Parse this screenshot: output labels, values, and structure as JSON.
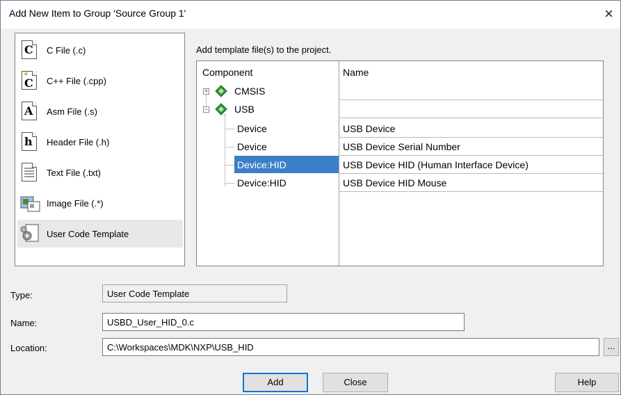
{
  "window": {
    "title": "Add New Item to Group 'Source Group 1'",
    "close_glyph": "×"
  },
  "file_types": [
    {
      "label": "C File (.c)",
      "icon": "c-file-icon",
      "glyph": "C"
    },
    {
      "label": "C++ File (.cpp)",
      "icon": "cpp-file-icon",
      "glyph": "C"
    },
    {
      "label": "Asm File (.s)",
      "icon": "asm-file-icon",
      "glyph": "A"
    },
    {
      "label": "Header File (.h)",
      "icon": "header-file-icon",
      "glyph": "h"
    },
    {
      "label": "Text File (.txt)",
      "icon": "text-file-icon",
      "glyph": ""
    },
    {
      "label": "Image File (.*)",
      "icon": "image-file-icon",
      "glyph": ""
    },
    {
      "label": "User Code Template",
      "icon": "user-code-template-icon",
      "glyph": ""
    }
  ],
  "selected_file_type": "User Code Template",
  "template_hint": "Add template file(s) to the project.",
  "tree": {
    "columns": [
      "Component",
      "Name"
    ],
    "rows": [
      {
        "component": "CMSIS",
        "name": "",
        "expander": "+",
        "icon": "component-diamond-icon"
      },
      {
        "component": "USB",
        "name": "",
        "expander": "−",
        "icon": "component-diamond-icon"
      },
      {
        "component": "Device",
        "name": "USB Device"
      },
      {
        "component": "Device",
        "name": "USB Device Serial Number"
      },
      {
        "component": "Device:HID",
        "name": "USB Device HID (Human Interface Device)",
        "selected": true
      },
      {
        "component": "Device:HID",
        "name": "USB Device HID Mouse"
      }
    ]
  },
  "form": {
    "type_label": "Type:",
    "type_value": "User Code Template",
    "name_label": "Name:",
    "name_value": "USBD_User_HID_0.c",
    "location_label": "Location:",
    "location_value": "C:\\Workspaces\\MDK\\NXP\\USB_HID",
    "browse_label": "..."
  },
  "buttons": {
    "add": "Add",
    "close": "Close",
    "help": "Help"
  },
  "colors": {
    "selection": "#3c7fc8",
    "diamond": "#2e9a3a"
  }
}
